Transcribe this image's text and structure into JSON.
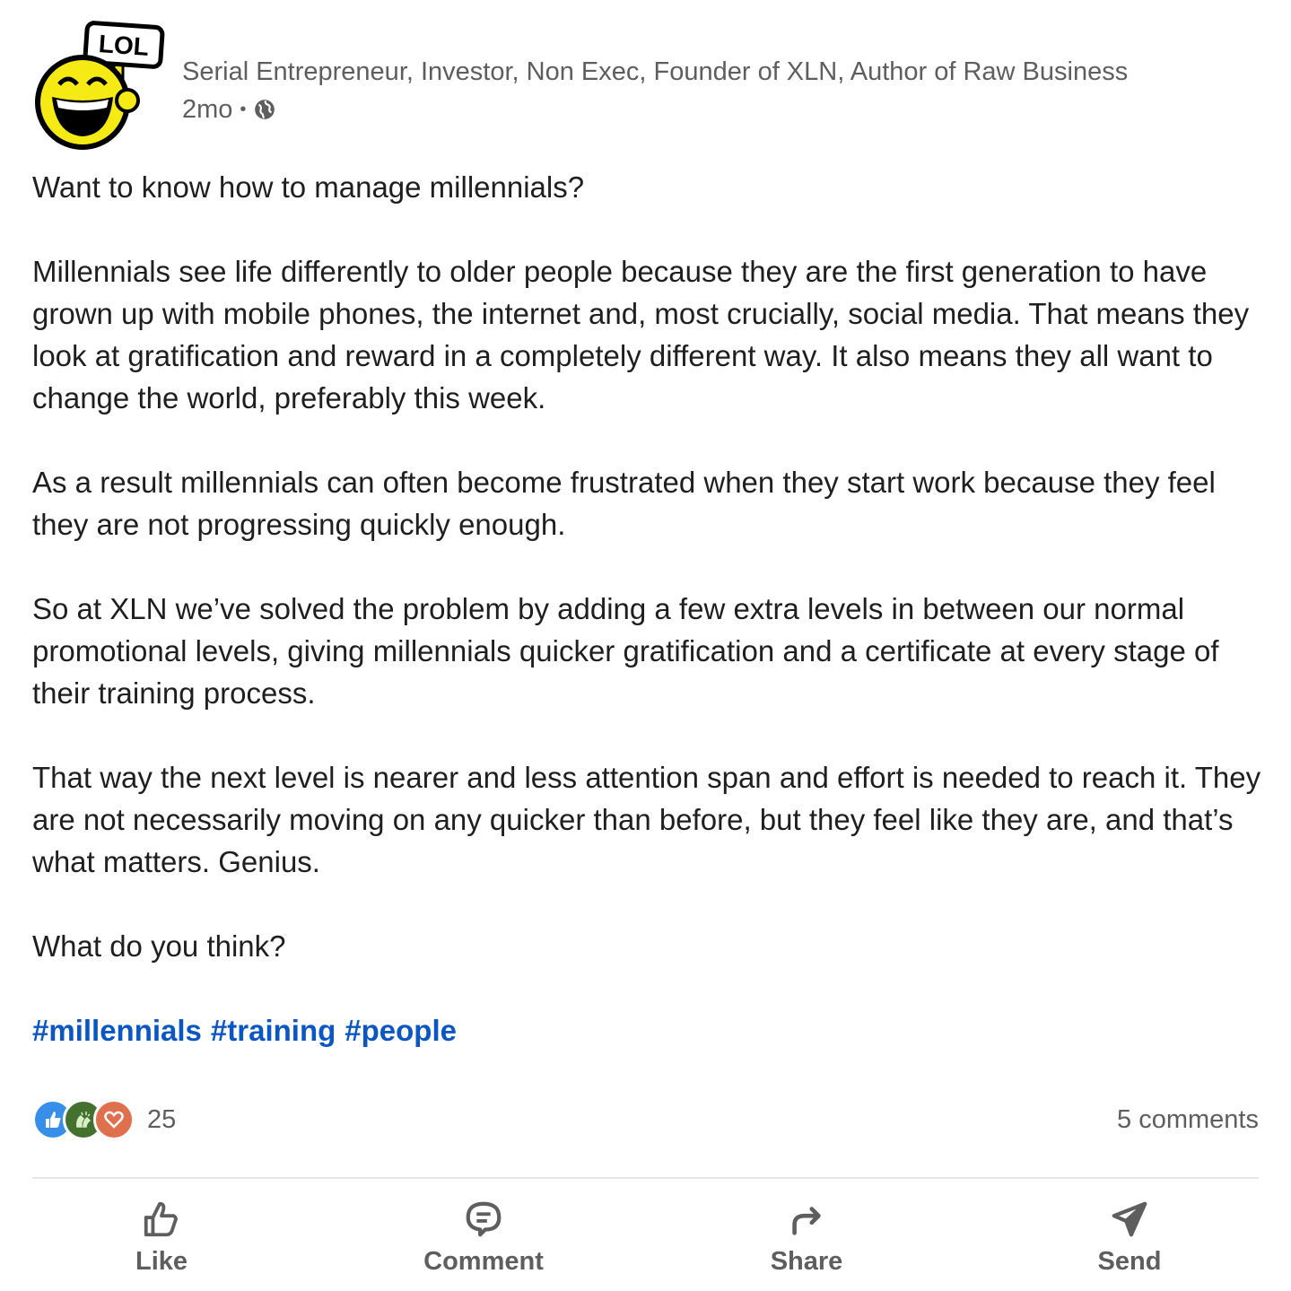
{
  "author": {
    "avatar_sign_text": "LOL",
    "headline": "Serial Entrepreneur, Investor, Non Exec, Founder of XLN, Author of Raw Business",
    "time_ago": "2mo",
    "separator": "•",
    "visibility_icon": "globe-icon"
  },
  "post": {
    "paragraphs": [
      "Want to know how to manage millennials?",
      "Millennials see life differently to older people because they are the first generation to have grown up with mobile phones, the internet and, most crucially, social media. That means they look at gratification and reward in a completely different way. It also means they all want to change the world, preferably this week.",
      "As a result millennials can often become frustrated when they start work because they feel they are not progressing quickly enough.",
      "So at XLN we’ve solved the problem by adding a few extra levels in between our normal promotional levels, giving millennials quicker gratification and a certificate at every stage of their training process.",
      "That way the next level is nearer and less attention span and effort is needed to reach it. They are not necessarily moving on any quicker than before, but they feel like they are, and that’s what matters. Genius.",
      "What do you think?"
    ],
    "hashtags": [
      "#millennials",
      "#training",
      "#people"
    ]
  },
  "social": {
    "reaction_icons": [
      "like-reaction-icon",
      "celebrate-reaction-icon",
      "love-reaction-icon"
    ],
    "reaction_count": "25",
    "comments_count": "5 comments"
  },
  "actions": [
    {
      "label": "Like",
      "icon": "thumbs-up-icon"
    },
    {
      "label": "Comment",
      "icon": "comment-bubble-icon"
    },
    {
      "label": "Share",
      "icon": "share-arrow-icon"
    },
    {
      "label": "Send",
      "icon": "paper-plane-icon"
    }
  ],
  "colors": {
    "hashtag": "#0a56c2",
    "muted_text": "#5e5e5e",
    "like_reaction": "#378fe9",
    "celebrate_reaction": "#44712e",
    "love_reaction": "#df704d"
  }
}
